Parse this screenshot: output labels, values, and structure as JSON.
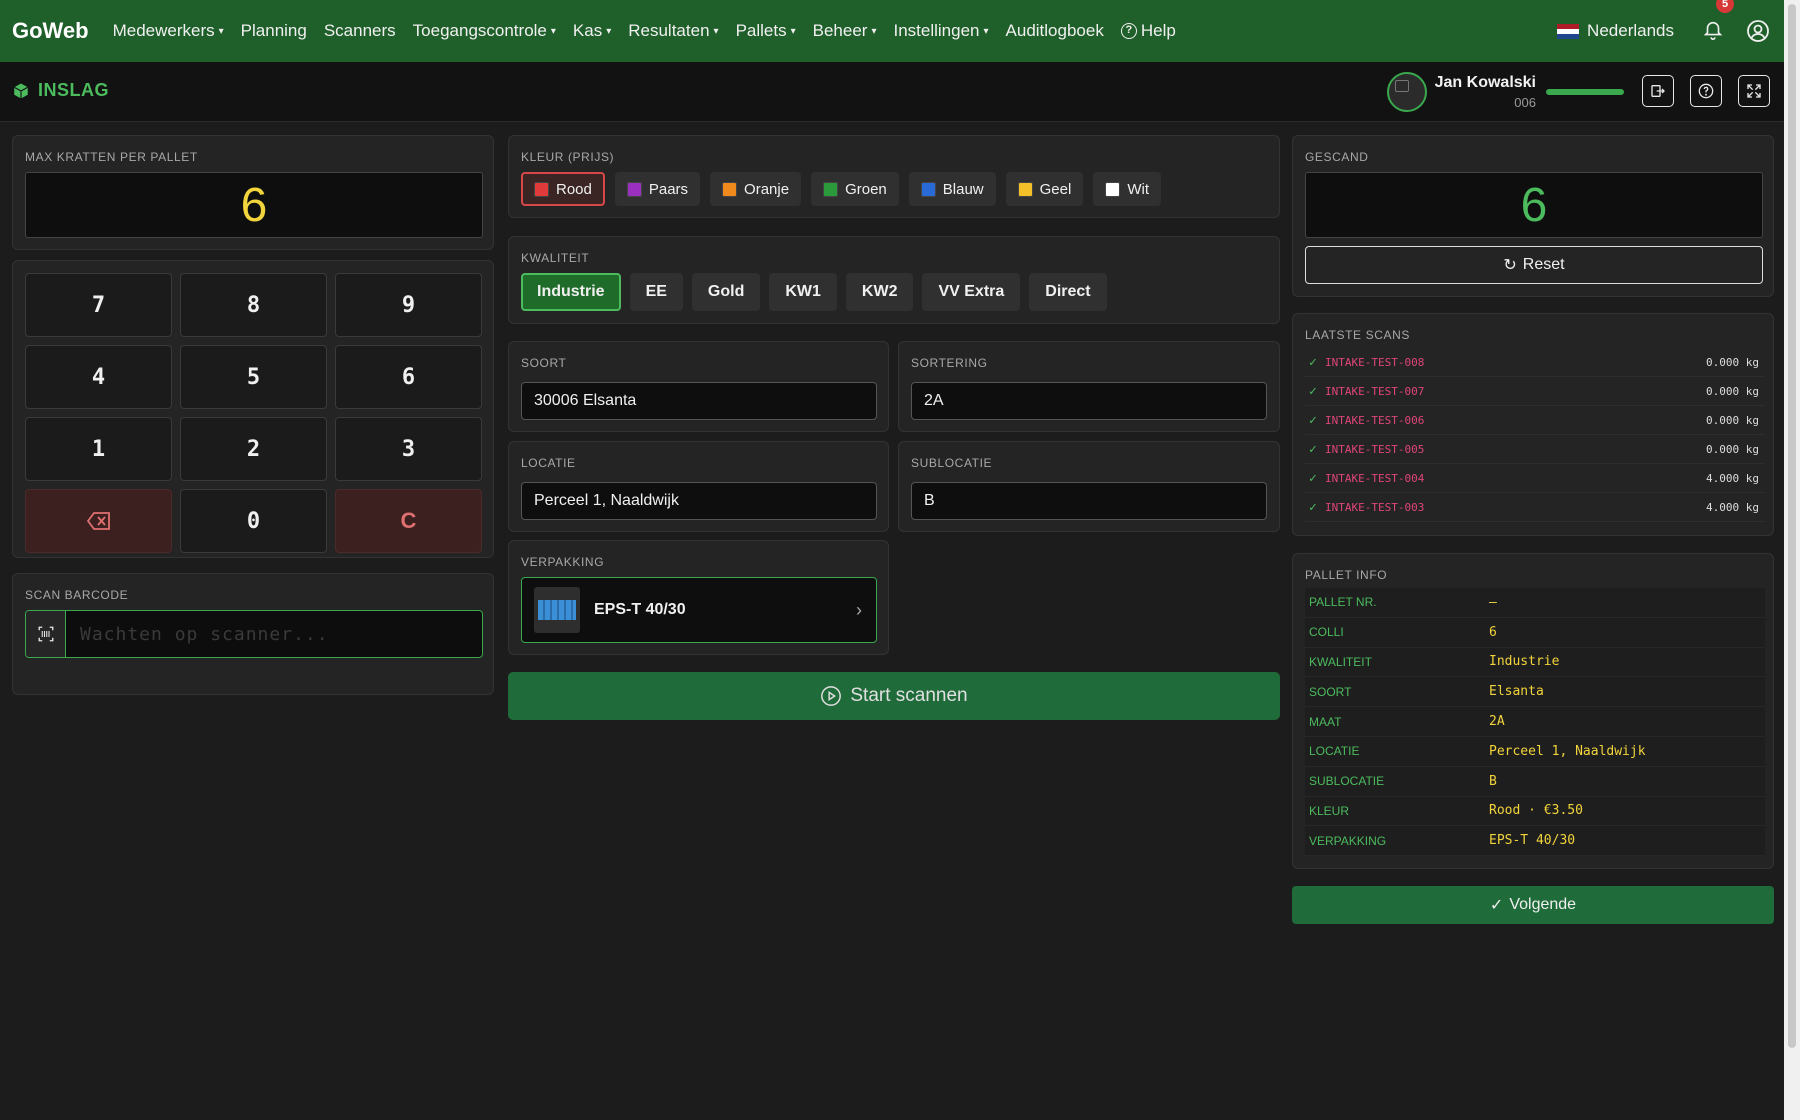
{
  "nav": {
    "brand": "GoWeb",
    "items": [
      {
        "label": "Medewerkers",
        "caret": true
      },
      {
        "label": "Planning",
        "caret": false
      },
      {
        "label": "Scanners",
        "caret": false
      },
      {
        "label": "Toegangscontrole",
        "caret": true
      },
      {
        "label": "Kas",
        "caret": true
      },
      {
        "label": "Resultaten",
        "caret": true
      },
      {
        "label": "Pallets",
        "caret": true
      },
      {
        "label": "Beheer",
        "caret": true
      },
      {
        "label": "Instellingen",
        "caret": true
      },
      {
        "label": "Auditlogboek",
        "caret": false
      }
    ],
    "help_label": "Help",
    "language": "Nederlands",
    "notification_count": "5"
  },
  "page": {
    "title": "INSLAG",
    "user_name": "Jan Kowalski",
    "user_code": "006",
    "user_progress": 1.0
  },
  "left": {
    "max_label": "MAX KRATTEN PER PALLET",
    "max_value": "6",
    "keys": [
      "7",
      "8",
      "9",
      "4",
      "5",
      "6",
      "1",
      "2",
      "3",
      "backspace",
      "0",
      "C"
    ],
    "scan_label": "SCAN BARCODE",
    "scan_placeholder": "Wachten op scanner..."
  },
  "middle": {
    "color_label": "KLEUR (PRIJS)",
    "colors": [
      {
        "label": "Rood",
        "swatch": "#e03a3a",
        "selected": true
      },
      {
        "label": "Paars",
        "swatch": "#9b30c0",
        "selected": false
      },
      {
        "label": "Oranje",
        "swatch": "#f08a1c",
        "selected": false
      },
      {
        "label": "Groen",
        "swatch": "#2a9a3a",
        "selected": false
      },
      {
        "label": "Blauw",
        "swatch": "#2a6ad6",
        "selected": false
      },
      {
        "label": "Geel",
        "swatch": "#f4c02a",
        "selected": false
      },
      {
        "label": "Wit",
        "swatch": "#ffffff",
        "selected": false
      }
    ],
    "quality_label": "KWALITEIT",
    "qualities": [
      {
        "label": "Industrie",
        "selected": true
      },
      {
        "label": "EE",
        "selected": false
      },
      {
        "label": "Gold",
        "selected": false
      },
      {
        "label": "KW1",
        "selected": false
      },
      {
        "label": "KW2",
        "selected": false
      },
      {
        "label": "VV Extra",
        "selected": false
      },
      {
        "label": "Direct",
        "selected": false
      }
    ],
    "soort_label": "SOORT",
    "soort_value": "30006 Elsanta",
    "sortering_label": "SORTERING",
    "sortering_value": "2A",
    "locatie_label": "LOCATIE",
    "locatie_value": "Perceel 1, Naaldwijk",
    "sublocatie_label": "SUBLOCATIE",
    "sublocatie_value": "B",
    "verpakking_label": "VERPAKKING",
    "verpakking_value": "EPS-T 40/30",
    "start_label": "Start scannen"
  },
  "right": {
    "scanned_label": "GESCAND",
    "scanned_value": "6",
    "reset_label": "Reset",
    "last_scans_label": "LAATSTE SCANS",
    "scans": [
      {
        "id": "INTAKE-TEST-008",
        "weight": "0.000 kg"
      },
      {
        "id": "INTAKE-TEST-007",
        "weight": "0.000 kg"
      },
      {
        "id": "INTAKE-TEST-006",
        "weight": "0.000 kg"
      },
      {
        "id": "INTAKE-TEST-005",
        "weight": "0.000 kg"
      },
      {
        "id": "INTAKE-TEST-004",
        "weight": "4.000 kg"
      },
      {
        "id": "INTAKE-TEST-003",
        "weight": "4.000 kg"
      }
    ],
    "pallet_info_label": "PALLET INFO",
    "pallet_info": [
      {
        "key": "PALLET NR.",
        "value": "–"
      },
      {
        "key": "COLLI",
        "value": "6"
      },
      {
        "key": "KWALITEIT",
        "value": "Industrie"
      },
      {
        "key": "SOORT",
        "value": "Elsanta"
      },
      {
        "key": "MAAT",
        "value": "2A"
      },
      {
        "key": "LOCATIE",
        "value": "Perceel 1, Naaldwijk"
      },
      {
        "key": "SUBLOCATIE",
        "value": "B"
      },
      {
        "key": "KLEUR",
        "value": "Rood · €3.50"
      },
      {
        "key": "VERPAKKING",
        "value": "EPS-T 40/30"
      }
    ],
    "next_label": "Volgende"
  },
  "colors": {
    "nav_bg": "#1f5f2a",
    "accent_green": "#4cbb5e",
    "accent_yellow": "#f2d43c",
    "scan_id_pink": "#e0447a"
  }
}
